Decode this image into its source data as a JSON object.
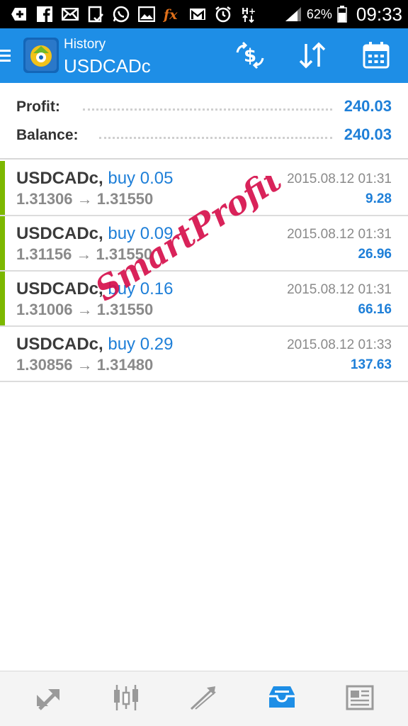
{
  "statusbar": {
    "battery_percent": "62%",
    "time": "09:33",
    "icons": [
      "add-icon",
      "facebook-icon",
      "mail-icon",
      "clipboard-icon",
      "whatsapp-icon",
      "image-icon",
      "fx-icon",
      "gmail-icon",
      "alarm-icon",
      "hplus-icon",
      "signal-icon",
      "battery-icon"
    ]
  },
  "toolbar": {
    "screen_title": "History",
    "symbol": "USDCADc",
    "actions": [
      "deposit-withdraw-icon",
      "sort-icon",
      "calendar-icon"
    ]
  },
  "summary": {
    "profit_label": "Profit:",
    "profit_value": "240.03",
    "balance_label": "Balance:",
    "balance_value": "240.03"
  },
  "deals": [
    {
      "symbol": "USDCADc,",
      "type": "buy 0.05",
      "prices": "1.31306 → 1.31550",
      "time": "2015.08.12 01:31",
      "profit": "9.28"
    },
    {
      "symbol": "USDCADc,",
      "type": "buy 0.09",
      "prices": "1.31156 → 1.31550",
      "time": "2015.08.12 01:31",
      "profit": "26.96"
    },
    {
      "symbol": "USDCADc,",
      "type": "buy 0.16",
      "prices": "1.31006 → 1.31550",
      "time": "2015.08.12 01:31",
      "profit": "66.16"
    },
    {
      "symbol": "USDCADc,",
      "type": "buy 0.29",
      "prices": "1.30856 → 1.31480",
      "time": "2015.08.12 01:33",
      "profit": "137.63"
    }
  ],
  "watermark": "SmartProfit",
  "bottomnav": {
    "items": [
      "quotes-icon",
      "chart-icon",
      "trade-icon",
      "history-icon",
      "news-icon"
    ],
    "active": "history-icon"
  },
  "colors": {
    "toolbar": "#1e8ee6",
    "accent_blue": "#1e7fd8",
    "profit_bar": "#7cb800",
    "watermark": "#d6104c"
  }
}
